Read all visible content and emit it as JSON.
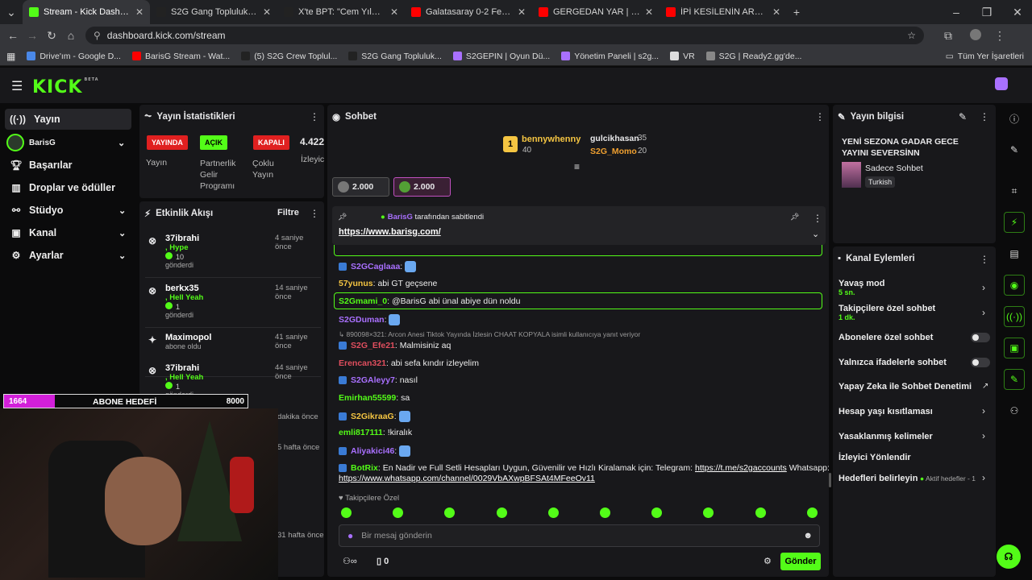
{
  "browser": {
    "tabs": [
      {
        "title": "Stream - Kick Dashboard",
        "active": true,
        "fav_color": "#53fc18"
      },
      {
        "title": "S2G Gang Topluluk / X",
        "active": false,
        "fav_color": "#222222"
      },
      {
        "title": "X'te BPT: \"Cem Yılmaz, Gora 4 G",
        "active": false,
        "fav_color": "#222222"
      },
      {
        "title": "Galatasaray 0-2 Fenerbahçe MA",
        "active": false,
        "fav_color": "#ff0000"
      },
      {
        "title": "GERGEDAN YAR | Madara Oldu",
        "active": false,
        "fav_color": "#ff0000"
      },
      {
        "title": "İPİ KESİLENİN ARABASI DÜŞER",
        "active": false,
        "fav_color": "#ff0000"
      }
    ],
    "url": "dashboard.kick.com/stream",
    "bookmarks": [
      "Drive'ım - Google D...",
      "BarisG Stream - Wat...",
      "(5) S2G Crew Toplul...",
      "S2G Gang Topluluk...",
      "S2GEPIN | Oyun Dü...",
      "Yönetim Paneli | s2g...",
      "VR",
      "S2G | Ready2.gg'de..."
    ],
    "bookmarks_all": "Tüm Yer İşaretleri"
  },
  "kick": {
    "logo": "KICK",
    "beta": "BETA",
    "nav": {
      "yayin": "Yayın",
      "channel": "BarisG",
      "basarilar": "Başarılar",
      "droplar": "Droplar ve ödüller",
      "studyo": "Stüdyo",
      "kanal": "Kanal",
      "ayarlar": "Ayarlar"
    }
  },
  "stats": {
    "title": "Yayın İstatistikleri",
    "yayinda": "YAYINDA",
    "acik": "AÇIK",
    "kapali": "KAPALI",
    "viewers": "4.422",
    "lbl_yayin": "Yayın",
    "lbl_partner": "Partnerlik Gelir Programı",
    "lbl_coklu": "Çoklu Yayın",
    "lbl_izleyici": "İzleyici"
  },
  "activity": {
    "title": "Etkinlik Akışı",
    "filter": "Filtre",
    "items": [
      {
        "name": "37ibrahi",
        "detail": ", Hype",
        "count": "10",
        "action": "gönderdi",
        "time": "4 saniye önce"
      },
      {
        "name": "berkx35",
        "detail": ", Hell Yeah",
        "count": "1",
        "action": "gönderdi",
        "time": "14 saniye önce"
      },
      {
        "name": "Maximopol",
        "detail": "",
        "count": "",
        "action": "abone oldu",
        "time": "41 saniye önce"
      },
      {
        "name": "37ibrahi",
        "detail": ", Hell Yeah",
        "count": "1",
        "action": "gönderdi",
        "time": "44 saniye önce"
      }
    ],
    "more_times": [
      "dakika önce",
      "5 hafta önce",
      "31 hafta önce"
    ]
  },
  "goal": {
    "current": "1664",
    "label": "ABONE HEDEFİ",
    "target": "8000",
    "progress": 0.208
  },
  "chat": {
    "title": "Sohbet",
    "leaders": [
      {
        "name": "bennywhenny",
        "count": "40"
      },
      {
        "name": "gulcikhasan",
        "count": "35"
      },
      {
        "name": "S2G_Momo",
        "count": "20"
      }
    ],
    "goals": [
      "2.000",
      "2.000"
    ],
    "pinned_by": "BarisG",
    "pinned_suffix": "tarafından sabitlendi",
    "pinned_link": "https://www.barisg.com/",
    "messages": [
      {
        "user": "S2GCaglaaa",
        "color": "#a970ff",
        "text": ""
      },
      {
        "user": "57yunus",
        "color": "#f5c542",
        "text": "abi GT geçsene"
      },
      {
        "user": "S2Gmami_0",
        "color": "#53fc18",
        "text": "@BarisG abi ünal abiye dün noldu"
      },
      {
        "user": "S2GDuman",
        "color": "#a970ff",
        "text": ""
      },
      {
        "user": "S2G_Efe21",
        "color": "#e04e5e",
        "text": "Malmisiniz aq"
      },
      {
        "user": "Erencan321",
        "color": "#e04e5e",
        "text": "abi sefa kındır izleyelim"
      },
      {
        "user": "S2GAleyy7",
        "color": "#a970ff",
        "text": "nasıl"
      },
      {
        "user": "Emirhan55599",
        "color": "#53fc18",
        "text": "sa"
      },
      {
        "user": "S2GikraaG",
        "color": "#f5c542",
        "text": ""
      },
      {
        "user": "emli817111",
        "color": "#53fc18",
        "text": "!kiralık"
      },
      {
        "user": "Aliyakici46",
        "color": "#a970ff",
        "text": ""
      },
      {
        "user": "BotRix",
        "color": "#53fc18",
        "text": "En Nadir ve Full Setli Hesapları Uygun, Güvenilir ve Hızlı Kiralamak için: Telegram:"
      }
    ],
    "reply_note": "890098×321: Arcon Anesi Tiktok Yayında İzlesin CHAAT KOPYALA isimli kullanıcıya yanıt veriyor",
    "botrix_tg": "https://t.me/s2gaccounts",
    "botrix_wa_label": "Whatsapp:",
    "botrix_wa": "https://www.whatsapp.com/channel/0029VbAXwpBFSAt4MFeeOv11",
    "followers_only": "Takipçilere Özel",
    "input_placeholder": "Bir mesaj gönderin",
    "send": "Gönder",
    "count": "0"
  },
  "info": {
    "title": "Yayın bilgisi",
    "stream_title": "YENİ SEZONA GADAR GECE YAYINI SEVERSİNN",
    "category": "Sadece Sohbet",
    "language": "Turkish"
  },
  "actions": {
    "title": "Kanal Eylemleri",
    "slow": "Yavaş mod",
    "slow_val": "5 sn.",
    "followers": "Takipçilere özel sohbet",
    "followers_val": "1 dk.",
    "subs": "Abonelere özel sohbet",
    "emotes": "Yalnızca ifadelerle sohbet",
    "ai": "Yapay Zeka ile Sohbet Denetimi",
    "age": "Hesap yaşı kısıtlaması",
    "banned": "Yasaklanmış kelimeler",
    "redirect": "İzleyici Yönlendir",
    "goals": "Hedefleri belirleyin",
    "goals_active": "Aktif hedefler - 1"
  }
}
